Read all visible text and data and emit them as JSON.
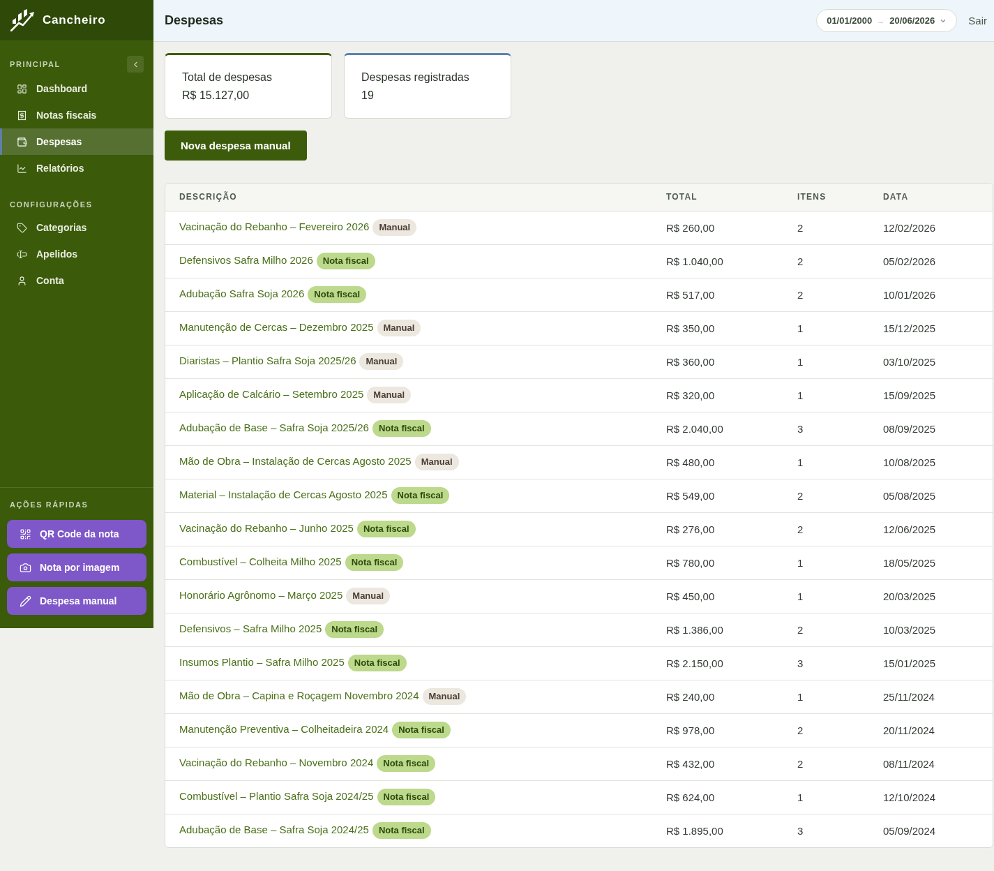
{
  "app": {
    "name": "Cancheiro"
  },
  "sidebar": {
    "sections": [
      {
        "title": "PRINCIPAL",
        "items": [
          {
            "label": "Dashboard",
            "selected": false
          },
          {
            "label": "Notas fiscais",
            "selected": false
          },
          {
            "label": "Despesas",
            "selected": true
          },
          {
            "label": "Relatórios",
            "selected": false
          }
        ]
      },
      {
        "title": "CONFIGURAÇÕES",
        "items": [
          {
            "label": "Categorias",
            "selected": false
          },
          {
            "label": "Apelidos",
            "selected": false
          },
          {
            "label": "Conta",
            "selected": false
          }
        ]
      }
    ],
    "quick_actions": {
      "title": "AÇÕES RÁPIDAS",
      "buttons": [
        "QR Code da nota",
        "Nota por imagem",
        "Despesa manual"
      ]
    }
  },
  "header": {
    "title": "Despesas",
    "date_range": {
      "start": "01/01/2000",
      "separator": "→",
      "end": "20/06/2026"
    },
    "logout": "Sair"
  },
  "summary_cards": [
    {
      "label": "Total de despesas",
      "value": "R$ 15.127,00",
      "color": "#3d5c0b"
    },
    {
      "label": "Despesas registradas",
      "value": "19",
      "color": "#5b82b3"
    }
  ],
  "primary_button": "Nova despesa manual",
  "table": {
    "columns": [
      "DESCRIÇÃO",
      "TOTAL",
      "ITENS",
      "DATA"
    ],
    "rows": [
      {
        "description": "Vacinação do Rebanho – Fevereiro 2026",
        "tag": {
          "label": "Manual",
          "kind": "manual"
        },
        "total": "R$ 260,00",
        "items": "2",
        "date": "12/02/2026"
      },
      {
        "description": "Defensivos Safra Milho 2026",
        "tag": {
          "label": "Nota fiscal",
          "kind": "nota_fiscal"
        },
        "total": "R$ 1.040,00",
        "items": "2",
        "date": "05/02/2026"
      },
      {
        "description": "Adubação Safra Soja 2026",
        "tag": {
          "label": "Nota fiscal",
          "kind": "nota_fiscal"
        },
        "total": "R$ 517,00",
        "items": "2",
        "date": "10/01/2026"
      },
      {
        "description": "Manutenção de Cercas – Dezembro 2025",
        "tag": {
          "label": "Manual",
          "kind": "manual"
        },
        "total": "R$ 350,00",
        "items": "1",
        "date": "15/12/2025"
      },
      {
        "description": "Diaristas – Plantio Safra Soja 2025/26",
        "tag": {
          "label": "Manual",
          "kind": "manual"
        },
        "total": "R$ 360,00",
        "items": "1",
        "date": "03/10/2025"
      },
      {
        "description": "Aplicação de Calcário – Setembro 2025",
        "tag": {
          "label": "Manual",
          "kind": "manual"
        },
        "total": "R$ 320,00",
        "items": "1",
        "date": "15/09/2025"
      },
      {
        "description": "Adubação de Base – Safra Soja 2025/26",
        "tag": {
          "label": "Nota fiscal",
          "kind": "nota_fiscal"
        },
        "total": "R$ 2.040,00",
        "items": "3",
        "date": "08/09/2025"
      },
      {
        "description": "Mão de Obra – Instalação de Cercas Agosto 2025",
        "tag": {
          "label": "Manual",
          "kind": "manual"
        },
        "total": "R$ 480,00",
        "items": "1",
        "date": "10/08/2025"
      },
      {
        "description": "Material – Instalação de Cercas Agosto 2025",
        "tag": {
          "label": "Nota fiscal",
          "kind": "nota_fiscal"
        },
        "total": "R$ 549,00",
        "items": "2",
        "date": "05/08/2025"
      },
      {
        "description": "Vacinação do Rebanho – Junho 2025",
        "tag": {
          "label": "Nota fiscal",
          "kind": "nota_fiscal"
        },
        "total": "R$ 276,00",
        "items": "2",
        "date": "12/06/2025"
      },
      {
        "description": "Combustível – Colheita Milho 2025",
        "tag": {
          "label": "Nota fiscal",
          "kind": "nota_fiscal"
        },
        "total": "R$ 780,00",
        "items": "1",
        "date": "18/05/2025"
      },
      {
        "description": "Honorário Agrônomo – Março 2025",
        "tag": {
          "label": "Manual",
          "kind": "manual"
        },
        "total": "R$ 450,00",
        "items": "1",
        "date": "20/03/2025"
      },
      {
        "description": "Defensivos – Safra Milho 2025",
        "tag": {
          "label": "Nota fiscal",
          "kind": "nota_fiscal"
        },
        "total": "R$ 1.386,00",
        "items": "2",
        "date": "10/03/2025"
      },
      {
        "description": "Insumos Plantio – Safra Milho 2025",
        "tag": {
          "label": "Nota fiscal",
          "kind": "nota_fiscal"
        },
        "total": "R$ 2.150,00",
        "items": "3",
        "date": "15/01/2025"
      },
      {
        "description": "Mão de Obra – Capina e Roçagem Novembro 2024",
        "tag": {
          "label": "Manual",
          "kind": "manual"
        },
        "total": "R$ 240,00",
        "items": "1",
        "date": "25/11/2024"
      },
      {
        "description": "Manutenção Preventiva – Colheitadeira 2024",
        "tag": {
          "label": "Nota fiscal",
          "kind": "nota_fiscal"
        },
        "total": "R$ 978,00",
        "items": "2",
        "date": "20/11/2024"
      },
      {
        "description": "Vacinação do Rebanho – Novembro 2024",
        "tag": {
          "label": "Nota fiscal",
          "kind": "nota_fiscal"
        },
        "total": "R$ 432,00",
        "items": "2",
        "date": "08/11/2024"
      },
      {
        "description": "Combustível – Plantio Safra Soja 2024/25",
        "tag": {
          "label": "Nota fiscal",
          "kind": "nota_fiscal"
        },
        "total": "R$ 624,00",
        "items": "1",
        "date": "12/10/2024"
      },
      {
        "description": "Adubação de Base – Safra Soja 2024/25",
        "tag": {
          "label": "Nota fiscal",
          "kind": "nota_fiscal"
        },
        "total": "R$ 1.895,00",
        "items": "3",
        "date": "05/09/2024"
      }
    ]
  }
}
